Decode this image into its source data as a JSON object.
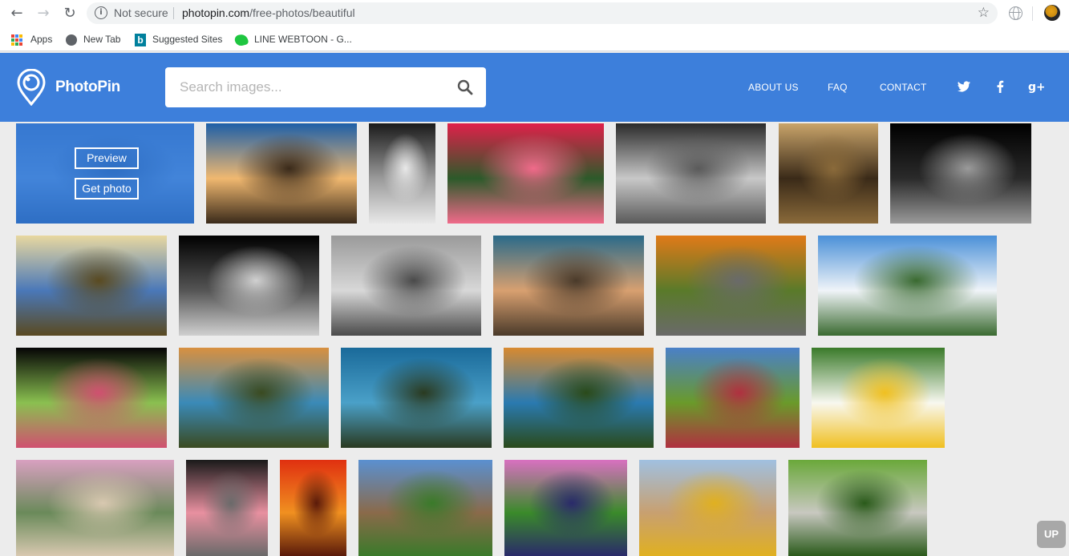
{
  "browser": {
    "security_label": "Not secure",
    "url_host": "photopin.com",
    "url_path": "/free-photos/beautiful",
    "bookmarks": [
      {
        "label": "Apps",
        "icon": "apps-grid-icon"
      },
      {
        "label": "New Tab",
        "icon": "globe-icon"
      },
      {
        "label": "Suggested Sites",
        "icon": "bing-icon"
      },
      {
        "label": "LINE WEBTOON - G...",
        "icon": "line-webtoon-icon"
      }
    ]
  },
  "site": {
    "brand": "PhotoPin",
    "search": {
      "placeholder": "Search images..."
    },
    "nav": {
      "about": "ABOUT US",
      "faq": "FAQ",
      "contact": "CONTACT"
    },
    "social": [
      "twitter-icon",
      "facebook-icon",
      "google-plus-icon"
    ]
  },
  "hover_overlay": {
    "preview_label": "Preview",
    "get_photo_label": "Get photo"
  },
  "photos": [
    {
      "subject": "calm blue sea horizon",
      "colors": [
        "#2f6fc4",
        "#4a8ad8",
        "#1e5aa8"
      ]
    },
    {
      "subject": "coastal rocks at sunset",
      "colors": [
        "#1d5fa8",
        "#f0b870",
        "#3a2a1a"
      ]
    },
    {
      "subject": "black and white woman at doorway",
      "colors": [
        "#1a1a1a",
        "#9a9a9a",
        "#e8e8e8"
      ]
    },
    {
      "subject": "red christmas cactus flower",
      "colors": [
        "#e0204a",
        "#2c5a2a",
        "#f06a8a"
      ]
    },
    {
      "subject": "black and white binoculars over lake",
      "colors": [
        "#2a2a2a",
        "#c8c8c8",
        "#5a5a5a"
      ]
    },
    {
      "subject": "bamboo tubes bee hotel",
      "colors": [
        "#c9a46a",
        "#3a2a18",
        "#8a6a3a"
      ]
    },
    {
      "subject": "black and white flower on black",
      "colors": [
        "#000000",
        "#2a2a2a",
        "#9a9a9a"
      ]
    },
    {
      "subject": "sunlit cliffs by the sea",
      "colors": [
        "#e8d8a0",
        "#4a78b8",
        "#5a4a20"
      ]
    },
    {
      "subject": "black and white dahlia",
      "colors": [
        "#000000",
        "#555555",
        "#d0d0d0"
      ]
    },
    {
      "subject": "couple on foggy balcony",
      "colors": [
        "#9a9a9a",
        "#d8d8d8",
        "#4a4a4a"
      ]
    },
    {
      "subject": "cliffs at twilight sea",
      "colors": [
        "#2a6a8a",
        "#d8a070",
        "#4a3a2a"
      ]
    },
    {
      "subject": "autumn forest hillside",
      "colors": [
        "#e07a18",
        "#5a7a2a",
        "#6a6a6a"
      ]
    },
    {
      "subject": "alpine lake with clouds",
      "colors": [
        "#4a90d8",
        "#f0f4f8",
        "#3a6a30"
      ]
    },
    {
      "subject": "succulent on black",
      "colors": [
        "#050505",
        "#8ac050",
        "#d05070"
      ]
    },
    {
      "subject": "golden cove beach",
      "colors": [
        "#d89040",
        "#3a8ab8",
        "#3a4a20"
      ]
    },
    {
      "subject": "turquoise sea cliffs",
      "colors": [
        "#1a6a9a",
        "#4aa0c8",
        "#2a3a20"
      ]
    },
    {
      "subject": "sunset cliffs coastline",
      "colors": [
        "#d88a30",
        "#2a7ab0",
        "#2a4a1a"
      ]
    },
    {
      "subject": "victoria crowned pigeon",
      "colors": [
        "#4a80c8",
        "#6a9a2a",
        "#b03040"
      ]
    },
    {
      "subject": "white water lily",
      "colors": [
        "#3a7a2a",
        "#f8f8f0",
        "#f0c020"
      ]
    },
    {
      "subject": "woman with sunglasses outdoors",
      "colors": [
        "#d8a0c0",
        "#6a8a5a",
        "#d8c8b0"
      ]
    },
    {
      "subject": "ostrich with pink feathers",
      "colors": [
        "#1a1a1a",
        "#e890a0",
        "#6a6a6a"
      ]
    },
    {
      "subject": "red poppies",
      "colors": [
        "#e03010",
        "#f09020",
        "#5a1a0a"
      ]
    },
    {
      "subject": "wooden boardwalk by lake",
      "colors": [
        "#5a90d0",
        "#8a6a4a",
        "#3a7a2a"
      ]
    },
    {
      "subject": "pink osteospermum daisy",
      "colors": [
        "#d870c0",
        "#3a8a2a",
        "#2a2a6a"
      ]
    },
    {
      "subject": "dome of the rock jerusalem",
      "colors": [
        "#a0c0e0",
        "#c8a070",
        "#e0b020"
      ]
    },
    {
      "subject": "terraced garden stairs",
      "colors": [
        "#6aa83a",
        "#c8c8c0",
        "#2a5a1a"
      ]
    }
  ],
  "scroll_up_label": "UP"
}
